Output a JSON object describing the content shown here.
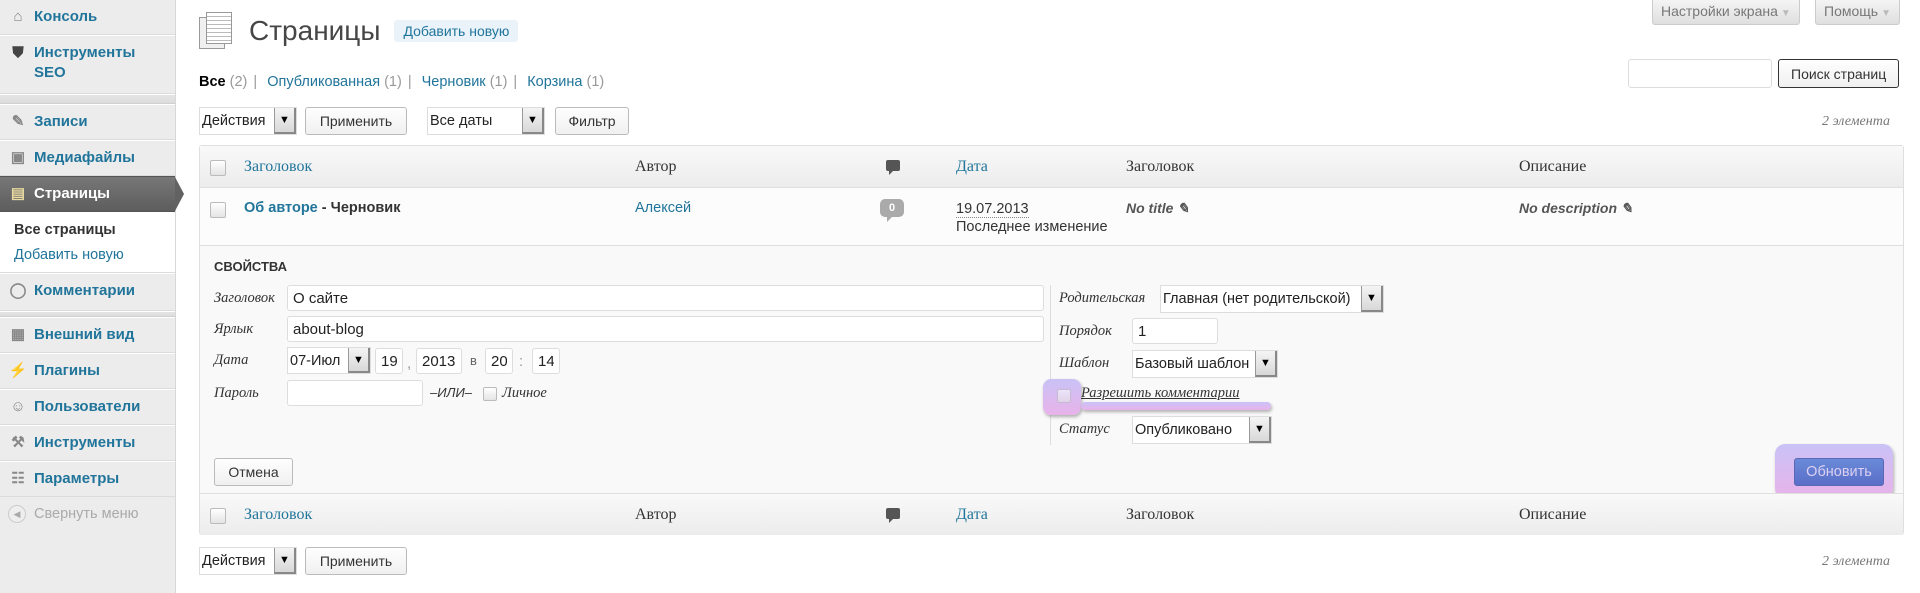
{
  "sidebar": {
    "items": [
      {
        "label": "Консоль",
        "icon": "house"
      },
      {
        "label": "Инструменты SEO",
        "icon": "shield"
      },
      {
        "label": "Записи",
        "icon": "pin"
      },
      {
        "label": "Медиафайлы",
        "icon": "media"
      },
      {
        "label": "Страницы",
        "icon": "pages",
        "active": true
      },
      {
        "label": "Комментарии",
        "icon": "comment"
      },
      {
        "label": "Внешний вид",
        "icon": "appearance"
      },
      {
        "label": "Плагины",
        "icon": "plug"
      },
      {
        "label": "Пользователи",
        "icon": "users"
      },
      {
        "label": "Инструменты",
        "icon": "tools"
      },
      {
        "label": "Параметры",
        "icon": "settings"
      }
    ],
    "submenu": {
      "all_pages": "Все страницы",
      "add_new": "Добавить новую"
    },
    "collapse": "Свернуть меню"
  },
  "top": {
    "screen_options": "Настройки экрана",
    "help": "Помощь"
  },
  "header": {
    "title": "Страницы",
    "add_new": "Добавить новую"
  },
  "filters": [
    {
      "label": "Все",
      "count": "(2)",
      "current": true
    },
    {
      "label": "Опубликованная",
      "count": "(1)"
    },
    {
      "label": "Черновик",
      "count": "(1)"
    },
    {
      "label": "Корзина",
      "count": "(1)"
    }
  ],
  "search": {
    "value": "",
    "button": "Поиск страниц"
  },
  "tablenav": {
    "bulk_actions": "Действия",
    "apply": "Применить",
    "dates": "Все даты",
    "filter": "Фильтр",
    "count": "2 элемента"
  },
  "columns": {
    "title": "Заголовок",
    "author": "Автор",
    "date": "Дата",
    "seo_title": "Заголовок",
    "description": "Описание"
  },
  "rows": [
    {
      "title": "Об авторе",
      "state": " - Черновик",
      "author": "Алексей",
      "comments": "0",
      "date": "19.07.2013",
      "date_status": "Последнее изменение",
      "seo_title": "No title",
      "description": "No description"
    }
  ],
  "inline_edit": {
    "legend": "СВОЙСТВА",
    "title_label": "Заголовок",
    "title_value": "О сайте",
    "slug_label": "Ярлык",
    "slug_value": "about-blog",
    "date_label": "Дата",
    "month": "07-Июл",
    "day": "19",
    "comma": ",",
    "year": "2013",
    "at": "в",
    "hour": "20",
    "colon": ":",
    "minute": "14",
    "password_label": "Пароль",
    "password_value": "",
    "or": "–ИЛИ–",
    "private_label": "Личное",
    "parent_label": "Родительская",
    "parent_value": "Главная (нет родительской)",
    "order_label": "Порядок",
    "order_value": "1",
    "template_label": "Шаблон",
    "template_value": "Базовый шаблон",
    "allow_comments": "Разрешить комментарии",
    "status_label": "Статус",
    "status_value": "Опубликовано",
    "cancel": "Отмена",
    "update": "Обновить"
  }
}
